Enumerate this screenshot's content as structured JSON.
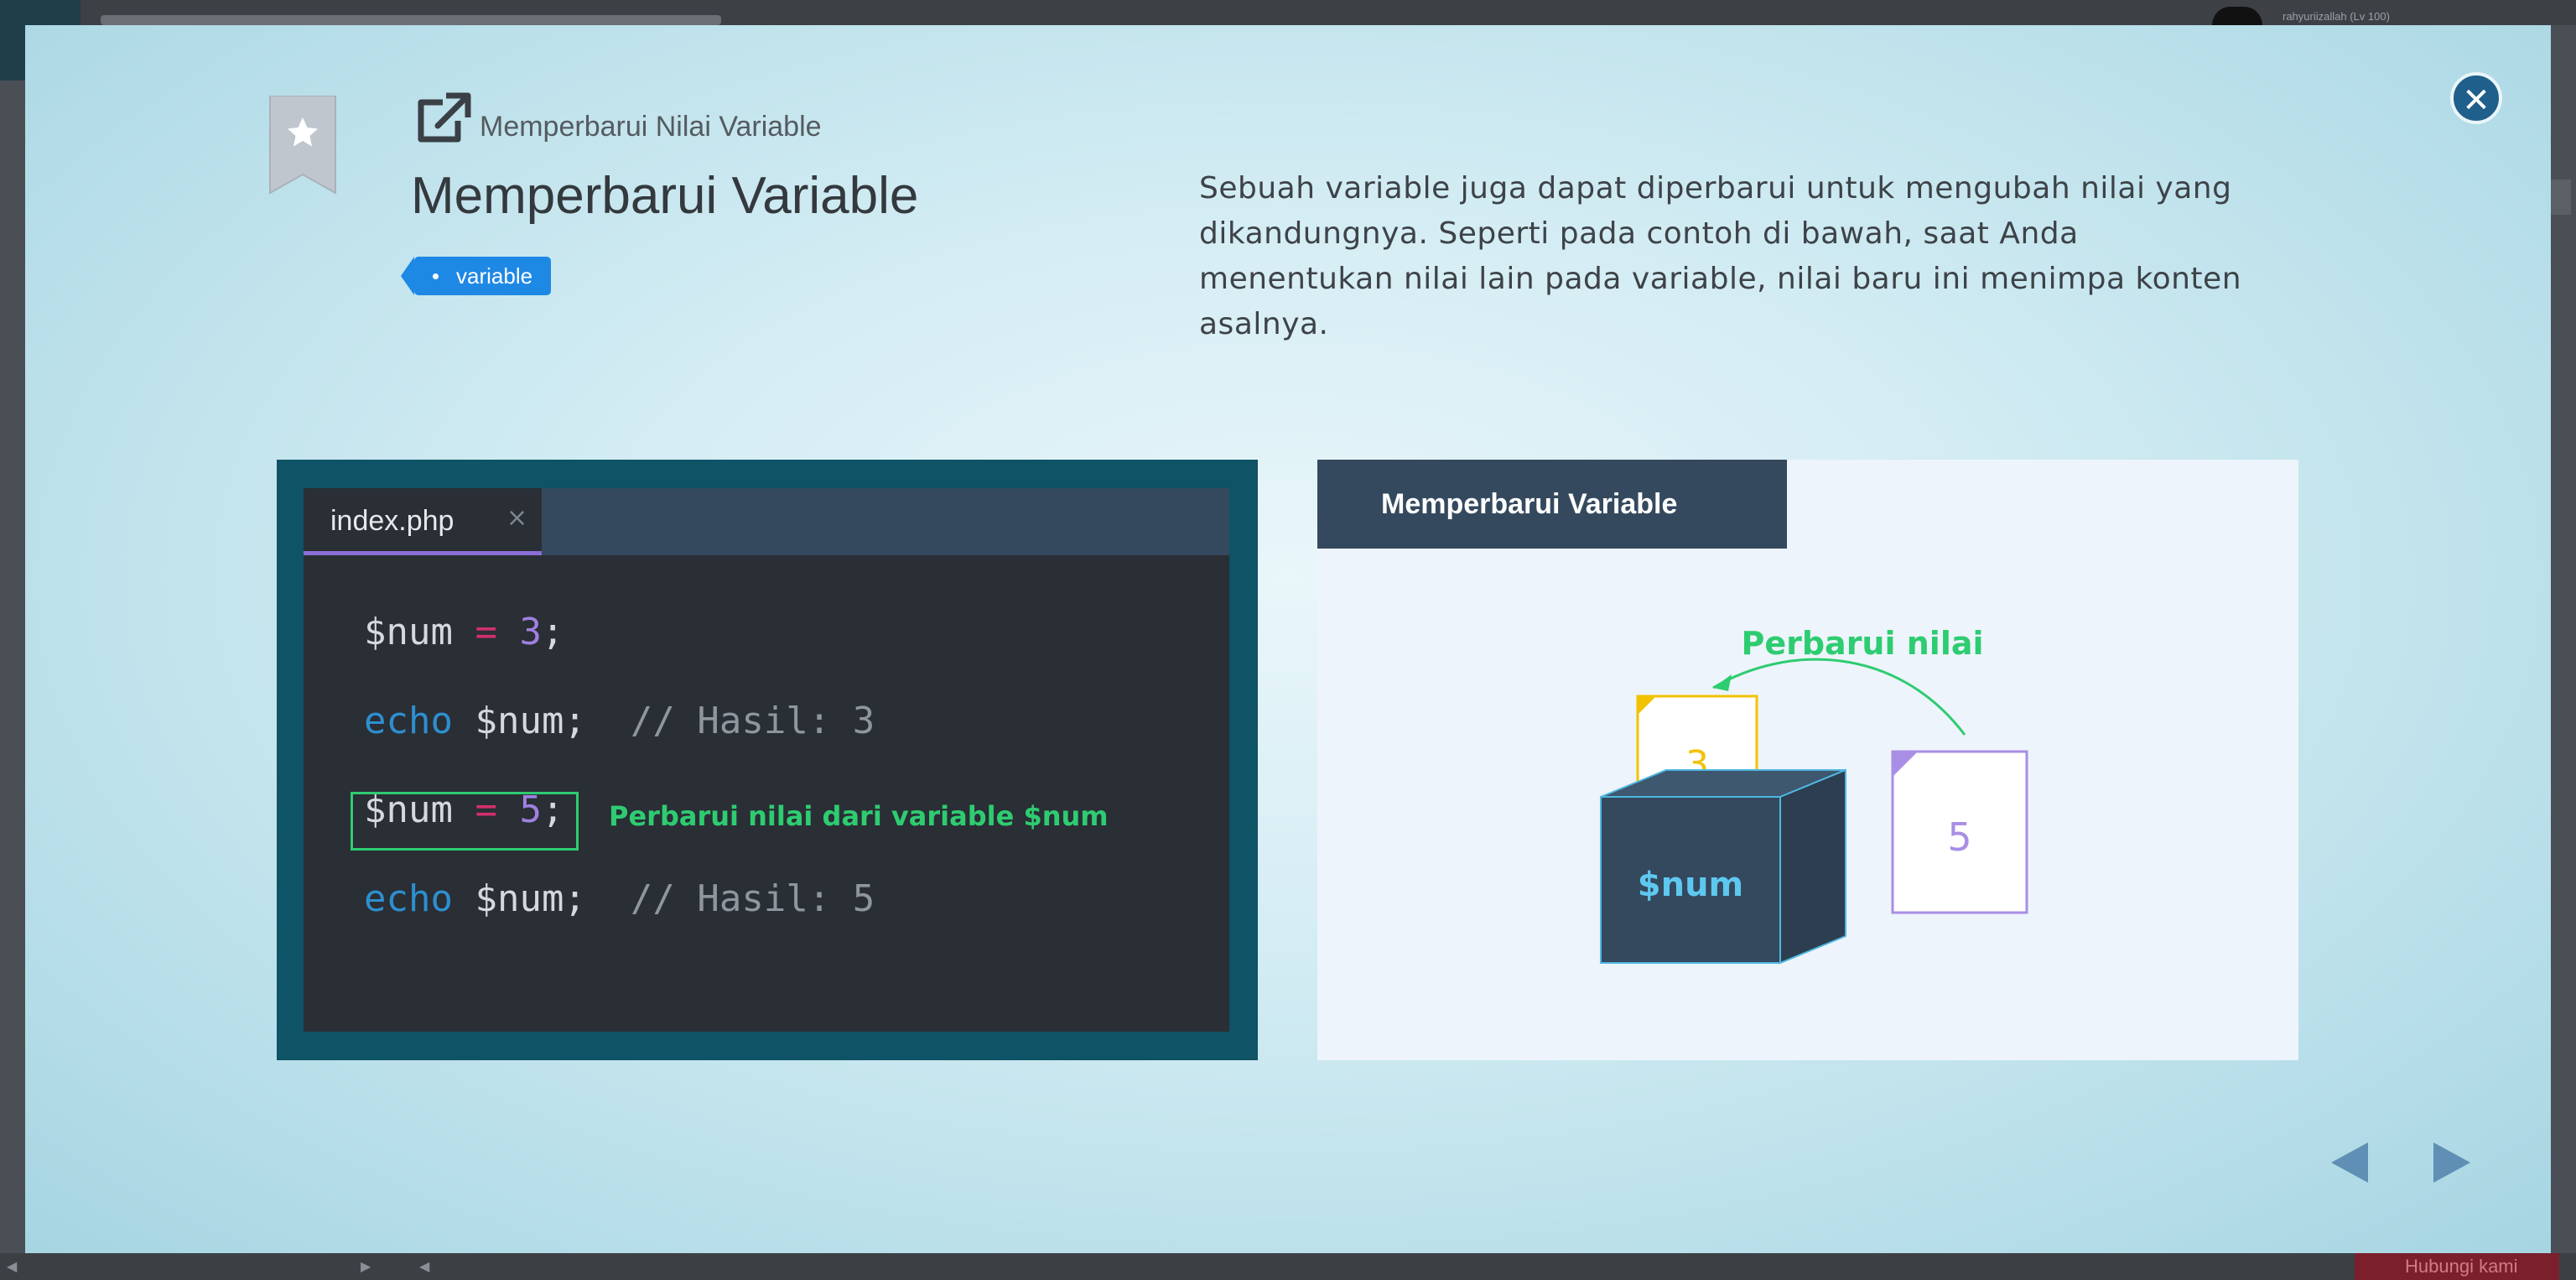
{
  "background": {
    "user_label": "rahyuriizallah (Lv 100)",
    "bottom_button": "Hubungi kami"
  },
  "modal": {
    "subtitle": "Memperbarui Nilai Variable",
    "title": "Memperbarui Variable",
    "tag": "variable",
    "description": "Sebuah variable juga dapat diperbarui untuk mengubah nilai yang dikandungnya. Seperti pada contoh di bawah, saat Anda menentukan nilai lain pada variable, nilai baru ini menimpa konten asalnya.",
    "close_icon": "close-icon",
    "nav": {
      "prev_icon": "triangle-left-icon",
      "next_icon": "triangle-right-icon"
    }
  },
  "editor": {
    "tab_name": "index.php",
    "tab_close": "×",
    "lines": [
      {
        "var": "$num",
        "op": "=",
        "val": "3",
        "end": ";"
      },
      {
        "kw": "echo",
        "var": "$num;",
        "comment": "// Hasil: 3"
      },
      {
        "var": "$num",
        "op": "=",
        "val": "5",
        "end": ";"
      },
      {
        "kw": "echo",
        "var": "$num;",
        "comment": "// Hasil: 5"
      }
    ],
    "annotation": "Perbarui nilai dari variable $num"
  },
  "illustration": {
    "header": "Memperbarui Variable",
    "arrow_label": "Perbarui nilai",
    "box_label": "$num",
    "old_value": "3",
    "new_value": "5",
    "colors": {
      "old": "#f2c200",
      "new": "#a98ee6",
      "box": "#34495e",
      "accent": "#2ecc71"
    }
  }
}
